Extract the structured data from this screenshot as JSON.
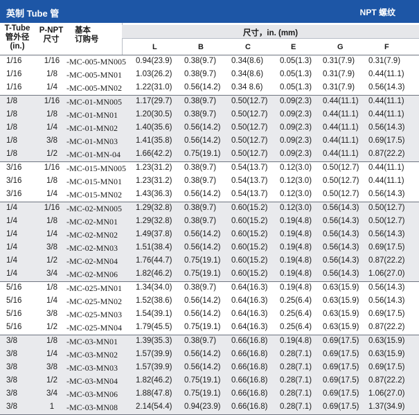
{
  "title": "英制 Tube 管",
  "title_right": "NPT 螺纹",
  "headers": {
    "tube_line1": "T-Tube",
    "tube_line2": "管外径",
    "tube_line3": "(in.)",
    "npt_line1": "P-NPT",
    "npt_line2": "尺寸",
    "order_line1": "基本",
    "order_line2": "订购号",
    "dims_title": "尺寸，in. (mm)",
    "cols": [
      "L",
      "B",
      "C",
      "E",
      "G",
      "F"
    ]
  },
  "groups": [
    {
      "shaded": false,
      "rows": [
        {
          "tube": "1/16",
          "npt": "1/16",
          "order": "-MC-005-MN005",
          "L": "0.94(23.9)",
          "B": "0.38(9.7)",
          "C": "0.34(8.6)",
          "E": "0.05(1.3)",
          "G": "0.31(7.9)",
          "F": "0.31(7.9)"
        },
        {
          "tube": "1/16",
          "npt": "1/8",
          "order": "-MC-005-MN01",
          "L": "1.03(26.2)",
          "B": "0.38(9.7)",
          "C": "0.34(8.6)",
          "E": "0.05(1.3)",
          "G": "0.31(7.9)",
          "F": "0.44(11.1)"
        },
        {
          "tube": "1/16",
          "npt": "1/4",
          "order": "-MC-005-MN02",
          "L": "1.22(31.0)",
          "B": "0.56(14.2)",
          "C": "0.34 8.6)",
          "E": "0.05(1.3)",
          "G": "0.31(7.9)",
          "F": "0.56(14.3)"
        }
      ]
    },
    {
      "shaded": true,
      "rows": [
        {
          "tube": "1/8",
          "npt": "1/16",
          "order": "-MC-01-MN005",
          "L": "1.17(29.7)",
          "B": "0.38(9.7)",
          "C": "0.50(12.7)",
          "E": "0.09(2.3)",
          "G": "0.44(11.1)",
          "F": "0.44(11.1)"
        },
        {
          "tube": "1/8",
          "npt": "1/8",
          "order": "-MC-01-MN01",
          "L": "1.20(30.5)",
          "B": "0.38(9.7)",
          "C": "0.50(12.7)",
          "E": "0.09(2.3)",
          "G": "0.44(11.1)",
          "F": "0.44(11.1)"
        },
        {
          "tube": "1/8",
          "npt": "1/4",
          "order": "-MC-01-MN02",
          "L": "1.40(35.6)",
          "B": "0.56(14.2)",
          "C": "0.50(12.7)",
          "E": "0.09(2.3)",
          "G": "0.44(11.1)",
          "F": "0.56(14.3)"
        },
        {
          "tube": "1/8",
          "npt": "3/8",
          "order": "-MC-01-MN03",
          "L": "1.41(35.8)",
          "B": "0.56(14.2)",
          "C": "0.50(12.7)",
          "E": "0.09(2.3)",
          "G": "0.44(11.1)",
          "F": "0.69(17.5)"
        },
        {
          "tube": "1/8",
          "npt": "1/2",
          "order": "-MC-01-MN-04",
          "L": "1.66(42.2)",
          "B": "0.75(19.1)",
          "C": "0.50(12.7)",
          "E": "0.09(2.3)",
          "G": "0.44(11.1)",
          "F": "0.87(22.2)"
        }
      ]
    },
    {
      "shaded": false,
      "rows": [
        {
          "tube": "3/16",
          "npt": "1/16",
          "order": "-MC-015-MN005",
          "L": "1.23(31.2)",
          "B": "0.38(9.7)",
          "C": "0.54(13.7)",
          "E": "0.12(3.0)",
          "G": "0.50(12.7)",
          "F": "0.44(11.1)"
        },
        {
          "tube": "3/16",
          "npt": "1/8",
          "order": "-MC-015-MN01",
          "L": "1.23(31.2)",
          "B": "0.38(9.7)",
          "C": "0.54(13.7)",
          "E": "0.12(3.0)",
          "G": "0.50(12.7)",
          "F": "0.44(11.1)"
        },
        {
          "tube": "3/16",
          "npt": "1/4",
          "order": "-MC-015-MN02",
          "L": "1.43(36.3)",
          "B": "0.56(14.2)",
          "C": "0.54(13.7)",
          "E": "0.12(3.0)",
          "G": "0.50(12.7)",
          "F": "0.56(14.3)"
        }
      ]
    },
    {
      "shaded": true,
      "rows": [
        {
          "tube": "1/4",
          "npt": "1/16",
          "order": "-MC-02-MN005",
          "L": "1.29(32.8)",
          "B": "0.38(9.7)",
          "C": "0.60(15.2)",
          "E": "0.12(3.0)",
          "G": "0.56(14.3)",
          "F": "0.50(12.7)"
        },
        {
          "tube": "1/4",
          "npt": "1/8",
          "order": "-MC-02-MN01",
          "L": "1.29(32.8)",
          "B": "0.38(9.7)",
          "C": "0.60(15.2)",
          "E": "0.19(4.8)",
          "G": "0.56(14.3)",
          "F": "0.50(12.7)"
        },
        {
          "tube": "1/4",
          "npt": "1/4",
          "order": "-MC-02-MN02",
          "L": "1.49(37.8)",
          "B": "0.56(14.2)",
          "C": "0.60(15.2)",
          "E": "0.19(4.8)",
          "G": "0.56(14.3)",
          "F": "0.56(14.3)"
        },
        {
          "tube": "1/4",
          "npt": "3/8",
          "order": "-MC-02-MN03",
          "L": "1.51(38.4)",
          "B": "0.56(14.2)",
          "C": "0.60(15.2)",
          "E": "0.19(4.8)",
          "G": "0.56(14.3)",
          "F": "0.69(17.5)"
        },
        {
          "tube": "1/4",
          "npt": "1/2",
          "order": "-MC-02-MN04",
          "L": "1.76(44.7)",
          "B": "0.75(19.1)",
          "C": "0.60(15.2)",
          "E": "0.19(4.8)",
          "G": "0.56(14.3)",
          "F": "0.87(22.2)"
        },
        {
          "tube": "1/4",
          "npt": "3/4",
          "order": "-MC-02-MN06",
          "L": "1.82(46.2)",
          "B": "0.75(19.1)",
          "C": "0.60(15.2)",
          "E": "0.19(4.8)",
          "G": "0.56(14.3)",
          "F": "1.06(27.0)"
        }
      ]
    },
    {
      "shaded": false,
      "rows": [
        {
          "tube": "5/16",
          "npt": "1/8",
          "order": "-MC-025-MN01",
          "L": "1.34(34.0)",
          "B": "0.38(9.7)",
          "C": "0.64(16.3)",
          "E": "0.19(4.8)",
          "G": "0.63(15.9)",
          "F": "0.56(14.3)"
        },
        {
          "tube": "5/16",
          "npt": "1/4",
          "order": "-MC-025-MN02",
          "L": "1.52(38.6)",
          "B": "0.56(14.2)",
          "C": "0.64(16.3)",
          "E": "0.25(6.4)",
          "G": "0.63(15.9)",
          "F": "0.56(14.3)"
        },
        {
          "tube": "5/16",
          "npt": "3/8",
          "order": "-MC-025-MN03",
          "L": "1.54(39.1)",
          "B": "0.56(14.2)",
          "C": "0.64(16.3)",
          "E": "0.25(6.4)",
          "G": "0.63(15.9)",
          "F": "0.69(17.5)"
        },
        {
          "tube": "5/16",
          "npt": "1/2",
          "order": "-MC-025-MN04",
          "L": "1.79(45.5)",
          "B": "0.75(19.1)",
          "C": "0.64(16.3)",
          "E": "0.25(6.4)",
          "G": "0.63(15.9)",
          "F": "0.87(22.2)"
        }
      ]
    },
    {
      "shaded": true,
      "rows": [
        {
          "tube": "3/8",
          "npt": "1/8",
          "order": "-MC-03-MN01",
          "L": "1.39(35.3)",
          "B": "0.38(9.7)",
          "C": "0.66(16.8)",
          "E": "0.19(4.8)",
          "G": "0.69(17.5)",
          "F": "0.63(15.9)"
        },
        {
          "tube": "3/8",
          "npt": "1/4",
          "order": "-MC-03-MN02",
          "L": "1.57(39.9)",
          "B": "0.56(14.2)",
          "C": "0.66(16.8)",
          "E": "0.28(7.1)",
          "G": "0.69(17.5)",
          "F": "0.63(15.9)"
        },
        {
          "tube": "3/8",
          "npt": "3/8",
          "order": "-MC-03-MN03",
          "L": "1.57(39.9)",
          "B": "0.56(14.2)",
          "C": "0.66(16.8)",
          "E": "0.28(7.1)",
          "G": "0.69(17.5)",
          "F": "0.69(17.5)"
        },
        {
          "tube": "3/8",
          "npt": "1/2",
          "order": "-MC-03-MN04",
          "L": "1.82(46.2)",
          "B": "0.75(19.1)",
          "C": "0.66(16.8)",
          "E": "0.28(7.1)",
          "G": "0.69(17.5)",
          "F": "0.87(22.2)"
        },
        {
          "tube": "3/8",
          "npt": "3/4",
          "order": "-MC-03-MN06",
          "L": "1.88(47.8)",
          "B": "0.75(19.1)",
          "C": "0.66(16.8)",
          "E": "0.28(7.1)",
          "G": "0.69(17.5)",
          "F": "1.06(27.0)"
        },
        {
          "tube": "3/8",
          "npt": "1",
          "order": "-MC-03-MN08",
          "L": "2.14(54.4)",
          "B": "0.94(23.9)",
          "C": "0.66(16.8)",
          "E": "0.28(7.1)",
          "G": "0.69(17.5)",
          "F": "1.37(34.9)"
        }
      ]
    }
  ]
}
